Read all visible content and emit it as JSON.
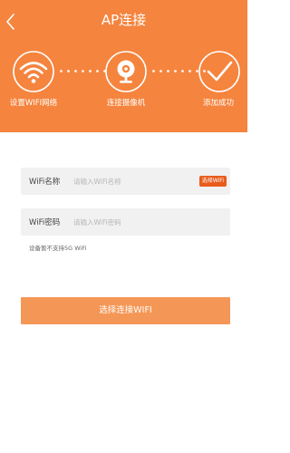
{
  "header": {
    "title": "AP连接",
    "background_color": "#f5843e"
  },
  "steps": [
    {
      "label": "设置WIFI网络",
      "icon": "wifi-icon"
    },
    {
      "label": "连接摄像机",
      "icon": "camera-icon"
    },
    {
      "label": "添加成功",
      "icon": "checkmark-icon"
    }
  ],
  "form": {
    "wifi_name": {
      "label": "WiFi名称",
      "placeholder": "请输入WiFi名称",
      "value": "",
      "select_button": "选择WiFi"
    },
    "wifi_password": {
      "label": "WiFi密码",
      "placeholder": "请输入WiFi密码",
      "value": ""
    },
    "note": "设备暂不支持5G WiFi"
  },
  "actions": {
    "connect_button": "选择连接WIFI",
    "button_color": "#f49756",
    "accent_color": "#e95c1c"
  }
}
